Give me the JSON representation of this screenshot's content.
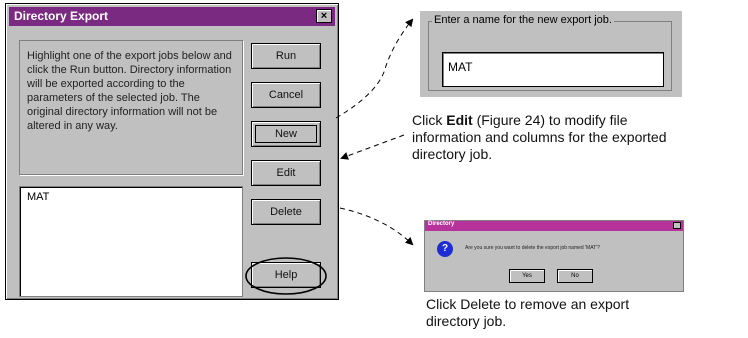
{
  "dialog": {
    "title": "Directory Export",
    "close_glyph": "×",
    "info_text": "Highlight one of the export jobs below and click the Run button. Directory information will be exported according to the parameters of the selected job. The original directory information will not be altered in any way.",
    "list_items": [
      "MAT"
    ],
    "buttons": {
      "run": "Run",
      "cancel": "Cancel",
      "new": "New",
      "edit": "Edit",
      "delete": "Delete",
      "help": "Help"
    }
  },
  "name_dialog": {
    "legend": "Enter a name for the new export job.",
    "value": "MAT"
  },
  "confirm_dialog": {
    "title": "Directory",
    "question": "Are you sure you want to delete the export job named 'MAT'?",
    "yes_label": "Yes",
    "no_label": "No"
  },
  "captions": {
    "edit_prefix": "Click ",
    "edit_bold": "Edit",
    "edit_rest_line1": " (Figure 24) to modify file",
    "edit_line2": "information and columns for the exported",
    "edit_line3": "directory job.",
    "delete_line1": "Click Delete to remove an export",
    "delete_line2": " directory job."
  },
  "colors": {
    "title_bar": "#7b2a82",
    "confirm_title_bar": "#b5339a",
    "dialog_face": "#c0c0c0"
  }
}
